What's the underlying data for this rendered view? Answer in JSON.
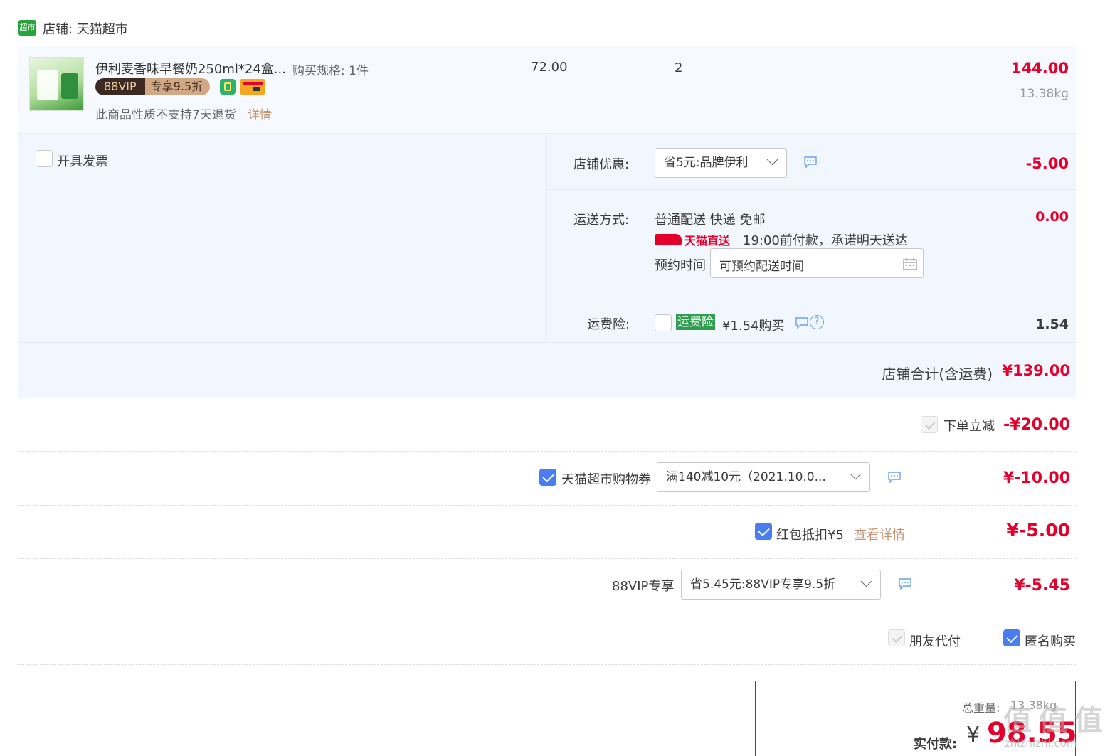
{
  "shop": {
    "name": "店铺: 天猫超市",
    "logo_text": "超市"
  },
  "item": {
    "title": "伊利麦香味早餐奶250ml*24盒...",
    "spec": "购买规格: 1件",
    "price": "72.00",
    "qty": "2",
    "subtotal": "144.00",
    "weight": "13.38kg",
    "vip_badge": "88VIP",
    "vip_discount": "专享9.5折",
    "return_note": "此商品性质不支持7天退货",
    "return_link": "详情"
  },
  "invoice": {
    "label": "开具发票"
  },
  "discount": {
    "label": "店铺优惠:",
    "value": "省5元:品牌伊利",
    "amount": "-5.00"
  },
  "shipping": {
    "label": "运送方式:",
    "method": "普通配送 快递 免邮",
    "badge": "天猫直送",
    "promise": "19:00前付款，承诺明天送达",
    "reserve_label": "预约时间",
    "reserve_placeholder": "可预约配送时间",
    "amount": "0.00"
  },
  "insurance": {
    "label": "运费险:",
    "tag": "运费险",
    "price": "¥1.54购买",
    "amount": "1.54"
  },
  "shop_total": {
    "label": "店铺合计(含运费)",
    "amount": "¥139.00"
  },
  "instant": {
    "label": "下单立减",
    "amount": "-¥20.00"
  },
  "coupon": {
    "label": "天猫超市购物券",
    "value": "满140减10元（2021.10.0...",
    "amount": "¥-10.00"
  },
  "redpacket": {
    "label": "红包抵扣¥5",
    "link": "查看详情",
    "amount": "¥-5.00"
  },
  "vip": {
    "label": "88VIP专享",
    "value": "省5.45元:88VIP专享9.5折",
    "amount": "¥-5.45"
  },
  "options": {
    "friend_pay": "朋友代付",
    "anonymous": "匿名购买"
  },
  "summary": {
    "weight_label": "总重量:",
    "weight_value": "13.38kg",
    "pay_label": "实付款:",
    "currency": "¥",
    "total": "98.55"
  },
  "watermark": {
    "text": "值 值 值",
    "url": "zhizhizhi.com"
  }
}
